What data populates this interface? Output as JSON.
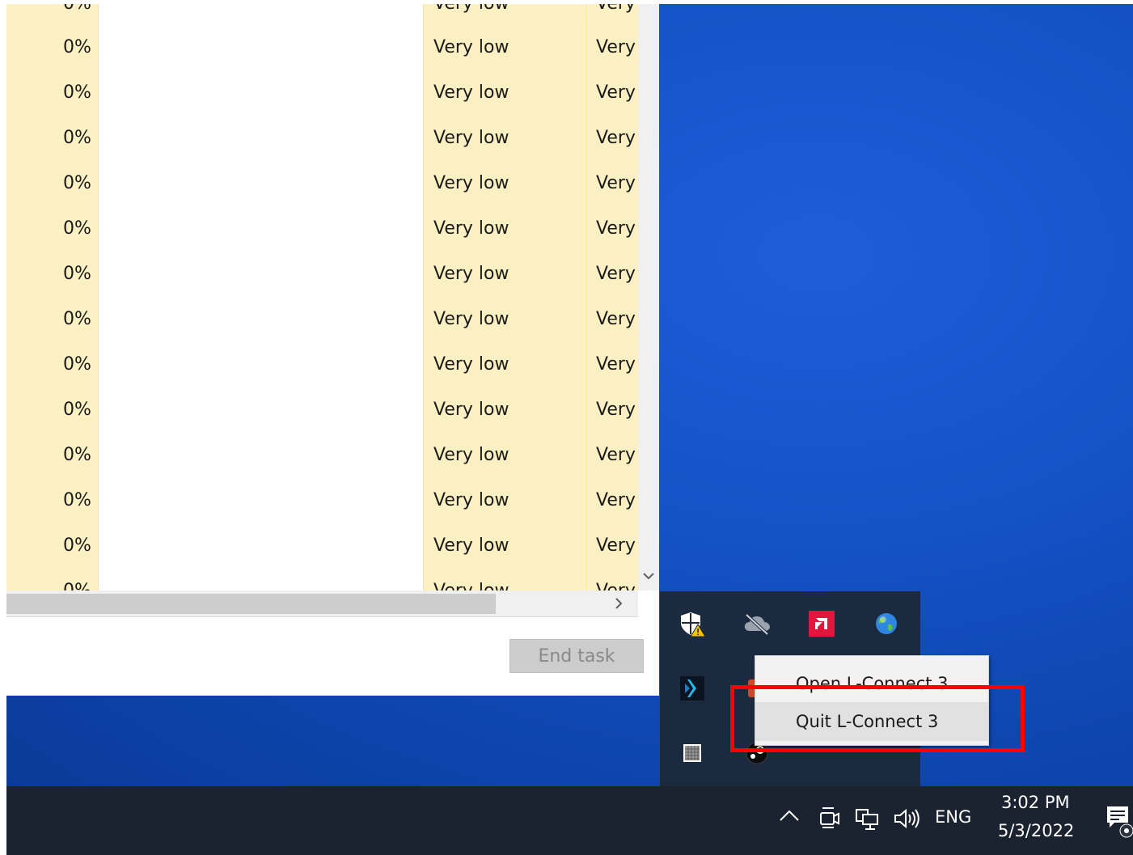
{
  "task_manager": {
    "rows": [
      {
        "cpu": "0%",
        "power": "Very low",
        "trend": "Very"
      },
      {
        "cpu": "0%",
        "power": "Very low",
        "trend": "Very"
      },
      {
        "cpu": "0%",
        "power": "Very low",
        "trend": "Very"
      },
      {
        "cpu": "0%",
        "power": "Very low",
        "trend": "Very"
      },
      {
        "cpu": "0%",
        "power": "Very low",
        "trend": "Very"
      },
      {
        "cpu": "0%",
        "power": "Very low",
        "trend": "Very"
      },
      {
        "cpu": "0%",
        "power": "Very low",
        "trend": "Very"
      },
      {
        "cpu": "0%",
        "power": "Very low",
        "trend": "Very"
      },
      {
        "cpu": "0%",
        "power": "Very low",
        "trend": "Very"
      },
      {
        "cpu": "0%",
        "power": "Very low",
        "trend": "Very"
      },
      {
        "cpu": "0%",
        "power": "Very low",
        "trend": "Very"
      },
      {
        "cpu": "0%",
        "power": "Very low",
        "trend": "Very"
      }
    ],
    "end_task_label": "End task"
  },
  "tray_flyout": {
    "icons": [
      "security-warning-icon",
      "cloud-offline-icon",
      "amd-radeon-icon",
      "network-globe-icon",
      "l-connect-icon",
      "app-icon",
      "grid-app-icon",
      "steam-icon"
    ]
  },
  "context_menu": {
    "open_label": "Open L-Connect 3",
    "quit_label": "Quit L-Connect 3"
  },
  "taskbar": {
    "language": "ENG",
    "time": "3:02 PM",
    "date": "5/3/2022"
  },
  "colors": {
    "highlight_box": "#ff0000",
    "row_highlight": "#fdf1c3",
    "taskbar": "#1c2330",
    "desktop": "#1553c9"
  }
}
